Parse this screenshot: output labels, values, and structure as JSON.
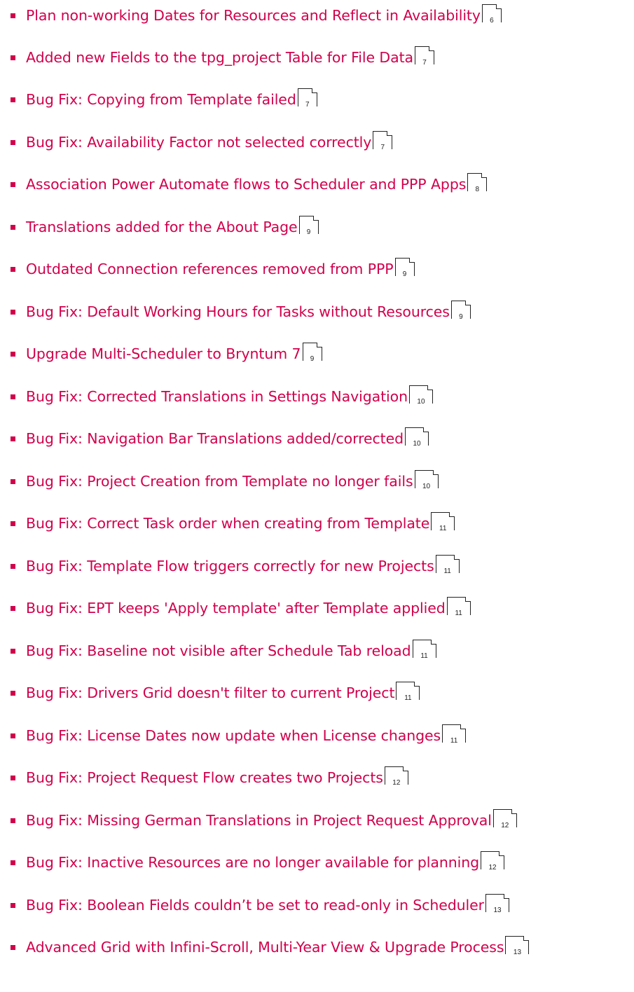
{
  "toc": {
    "accent_color": "#d2004b",
    "items": [
      {
        "title": "Plan non-working Dates for Resources and Reflect in Availability",
        "page": "6"
      },
      {
        "title": "Added new Fields to the tpg_project Table for File Data",
        "page": "7"
      },
      {
        "title": "Bug Fix: Copying from Template failed",
        "page": "7"
      },
      {
        "title": "Bug Fix: Availability Factor not selected correctly",
        "page": "7"
      },
      {
        "title": "Association Power Automate flows to Scheduler and PPP Apps",
        "page": "8"
      },
      {
        "title": "Translations added for the About Page",
        "page": "9"
      },
      {
        "title": "Outdated Connection references removed from PPP",
        "page": "9"
      },
      {
        "title": "Bug Fix: Default Working Hours for Tasks without Resources",
        "page": "9"
      },
      {
        "title": "Upgrade Multi-Scheduler to Bryntum 7",
        "page": "9"
      },
      {
        "title": "Bug Fix: Corrected Translations in Settings Navigation",
        "page": "10"
      },
      {
        "title": "Bug Fix: Navigation Bar Translations added/corrected",
        "page": "10"
      },
      {
        "title": "Bug Fix: Project Creation from Template no longer fails",
        "page": "10"
      },
      {
        "title": "Bug Fix: Correct Task order when creating from Template",
        "page": "11"
      },
      {
        "title": "Bug Fix: Template Flow triggers correctly for new Projects",
        "page": "11"
      },
      {
        "title": "Bug Fix: EPT keeps 'Apply template' after Template applied",
        "page": "11"
      },
      {
        "title": "Bug Fix: Baseline not visible after Schedule Tab reload",
        "page": "11"
      },
      {
        "title": "Bug Fix: Drivers Grid doesn't filter to current Project",
        "page": "11"
      },
      {
        "title": "Bug Fix: License Dates now update when License changes",
        "page": "11"
      },
      {
        "title": "Bug Fix: Project Request Flow creates two Projects",
        "page": "12"
      },
      {
        "title": "Bug Fix: Missing German Translations in Project Request Approval",
        "page": "12"
      },
      {
        "title": "Bug Fix: Inactive Resources are no longer available for planning",
        "page": "12"
      },
      {
        "title": "Bug Fix: Boolean Fields couldn’t be set to read-only in Scheduler",
        "page": "13"
      },
      {
        "title": "Advanced Grid with Infini-Scroll, Multi-Year View & Upgrade Process",
        "page": "13"
      }
    ]
  }
}
